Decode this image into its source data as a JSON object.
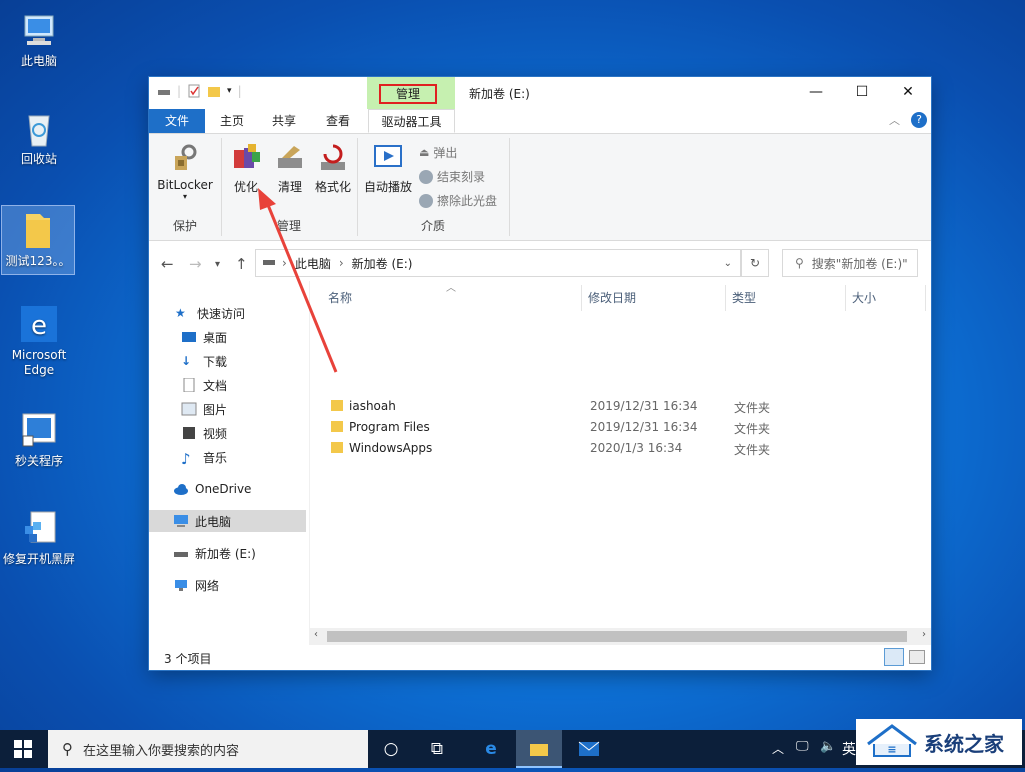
{
  "desktop_icons": [
    {
      "name": "desk-icon-this-pc",
      "label": "此电脑"
    },
    {
      "name": "desk-icon-recycle-bin",
      "label": "回收站"
    },
    {
      "name": "desk-icon-test-folder",
      "label": "测试123。。"
    },
    {
      "name": "desk-icon-edge",
      "label": "Microsoft Edge"
    },
    {
      "name": "desk-icon-shutdown-app",
      "label": "秒关程序"
    },
    {
      "name": "desk-icon-repair-app",
      "label": "修复开机黑屏"
    }
  ],
  "window": {
    "title": "新加卷 (E:)",
    "context_tab": "管理",
    "minimize": "—",
    "maximize": "☐",
    "close": "✕"
  },
  "tabs": {
    "file": "文件",
    "home": "主页",
    "share": "共享",
    "view": "查看",
    "drive_tools": "驱动器工具"
  },
  "ribbon": {
    "protect_group": "保护",
    "bitlocker": "BitLocker",
    "manage_group": "管理",
    "optimize": "优化",
    "cleanup": "清理",
    "format": "格式化",
    "media_group": "介质",
    "autoplay": "自动播放",
    "eject": "弹出",
    "finish_burn": "结束刻录",
    "erase_disc": "擦除此光盘"
  },
  "address": {
    "crumb_pc": "此电脑",
    "crumb_drive": "新加卷 (E:)",
    "search_placeholder": "搜索\"新加卷 (E:)\""
  },
  "nav": {
    "quick_access": "快速访问",
    "desktop": "桌面",
    "downloads": "下载",
    "documents": "文档",
    "pictures": "图片",
    "videos": "视频",
    "music": "音乐",
    "onedrive": "OneDrive",
    "this_pc": "此电脑",
    "drive_e": "新加卷 (E:)",
    "network": "网络"
  },
  "columns": {
    "name": "名称",
    "modified": "修改日期",
    "type": "类型",
    "size": "大小"
  },
  "files": [
    {
      "name": "iashoah",
      "modified": "2019/12/31 16:34",
      "type": "文件夹"
    },
    {
      "name": "Program Files",
      "modified": "2019/12/31 16:34",
      "type": "文件夹"
    },
    {
      "name": "WindowsApps",
      "modified": "2020/1/3 16:34",
      "type": "文件夹"
    }
  ],
  "status": {
    "item_count": "3 个项目"
  },
  "taskbar": {
    "search_placeholder": "在这里输入你要搜索的内容",
    "ime": "英"
  },
  "watermark": {
    "text": "系统之家"
  },
  "colors": {
    "accent": "#1e6fc8",
    "context_tab_bg": "#c6f0b0",
    "highlight_border": "#e02020",
    "arrow": "#e8423a"
  }
}
